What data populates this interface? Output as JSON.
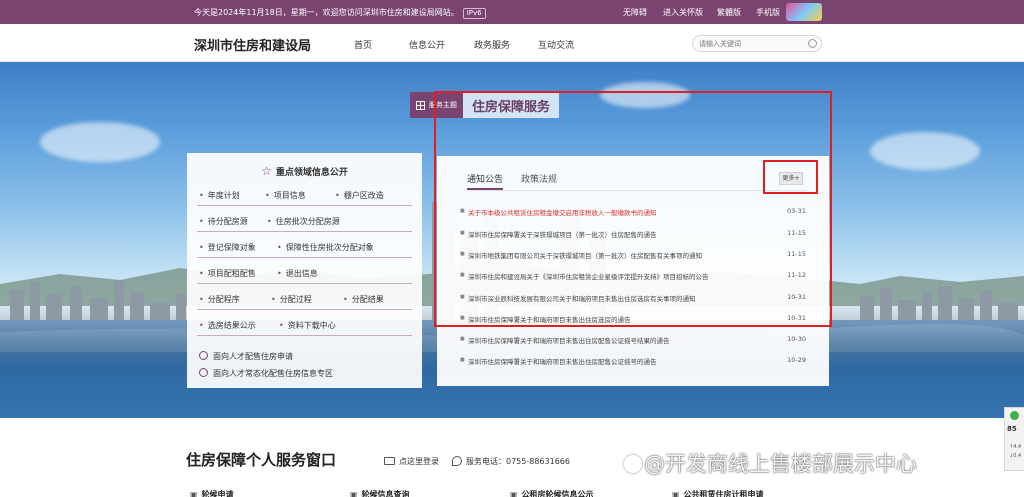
{
  "topbar": {
    "welcome": "今天是2024年11月18日，星期一，欢迎您访问深圳市住房和建设局网站。",
    "ipv6": "IPv6",
    "links": [
      "无障碍",
      "进入关怀版",
      "繁體版",
      "手机版"
    ]
  },
  "header": {
    "brand": "深圳市住房和建设局",
    "nav": [
      "首页",
      "信息公开",
      "政务服务",
      "互动交流"
    ],
    "search_placeholder": "请输入关键词"
  },
  "hero": {
    "theme_label": "服务主题",
    "theme_title": "住房保障服务"
  },
  "left_panel": {
    "title": "重点领域信息公开",
    "rows": [
      [
        "年度计划",
        "项目信息",
        "棚户区改造"
      ],
      [
        "待分配房源",
        "住房批次分配房源"
      ],
      [
        "登记保障对象",
        "保障性住房批次分配对象"
      ],
      [
        "项目配租配售",
        "退出信息"
      ],
      [
        "分配程序",
        "分配过程",
        "分配结果"
      ],
      [
        "选房结果公示",
        "资料下载中心"
      ]
    ],
    "special": [
      "面向人才配售住房申请",
      "面向人才常态化配售住房信息专区"
    ]
  },
  "right_panel": {
    "tabs": [
      "通知公告",
      "政策法规"
    ],
    "more": "更多+",
    "news": [
      {
        "title": "关于市本级公共租赁住房租金缴交启用非税收入一般缴款书的通知",
        "date": "03-31",
        "hot": true
      },
      {
        "title": "深圳市住房保障署关于深铁璟城项目（第一批次）住房配售的通告",
        "date": "11-15",
        "hot": false
      },
      {
        "title": "深圳市地铁集团有限公司关于深铁璟城项目（第一批次）住房配售有关事项的通知",
        "date": "11-15",
        "hot": false
      },
      {
        "title": "深圳市住房和建设局关于《深圳市住房租赁企业星级评定提升支持》项目招标的公告",
        "date": "11-12",
        "hot": false
      },
      {
        "title": "深圳市深业辰科技发展有限公司关于和瑞府项目未售出住房选房有关事项的通知",
        "date": "10-31",
        "hot": false
      },
      {
        "title": "深圳市住房保障署关于和瑞府项目未售出住房选房的通告",
        "date": "10-31",
        "hot": false
      },
      {
        "title": "深圳市住房保障署关于和瑞府项目未售出住房配售公证摇号结果的通告",
        "date": "10-30",
        "hot": false
      },
      {
        "title": "深圳市住房保障署关于和瑞府项目未售出住房配售公证摇号的通告",
        "date": "10-29",
        "hot": false
      }
    ]
  },
  "bottom": {
    "title": "住房保障个人服务窗口",
    "login": "点这里登录",
    "phone": "服务电话：0755-88631666",
    "cut_items": [
      "轮候申请",
      "轮候信息查询",
      "公租房轮候信息公示",
      "公共租赁住房计租申请"
    ]
  },
  "watermark": "@开发商线上售楼部展示中心",
  "side_widget": {
    "percent": "85",
    "lines": [
      "↑4.4",
      "↓0.4"
    ]
  },
  "colors": {
    "brand_purple": "#7a4470",
    "highlight_red": "#e02020",
    "hot_news_red": "#d9302a"
  }
}
